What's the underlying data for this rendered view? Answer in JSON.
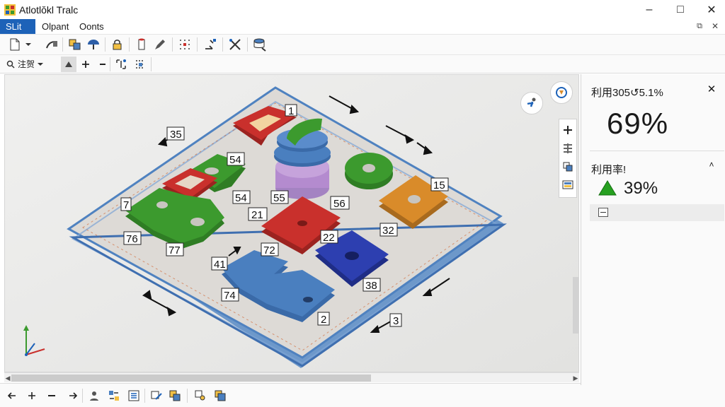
{
  "window": {
    "title": "Atlotlŏkl Tralc",
    "minimize": "–",
    "maximize": "□",
    "close": "✕"
  },
  "menu": {
    "items": [
      "SLit",
      "Olpant",
      "Oonts"
    ],
    "restore_icon": "⧉",
    "close_icon": "✕"
  },
  "toolbar2": {
    "zoom_label": "注贺"
  },
  "viewport": {
    "part_labels": [
      "35",
      "54",
      "54",
      "55",
      "56",
      "76",
      "77",
      "7",
      "21",
      "72",
      "22",
      "32",
      "15",
      "74",
      "38",
      "2",
      "41",
      "3"
    ],
    "dim_labels": [
      "1"
    ]
  },
  "panel": {
    "title": "利用305↺5.1%",
    "big_value": "69%",
    "section_title": "利用率!",
    "indicator_value": "39%",
    "close_icon": "✕",
    "collapse_icon": "˄"
  },
  "colors": {
    "accent": "#1d62b8",
    "plate": "#d9d6d2",
    "plate_edge": "#5f8fc6",
    "green": "#3c9a2e",
    "red": "#c9302c",
    "blue": "#2d3fb0",
    "steel": "#4a7fbf",
    "orange": "#d98b2a",
    "purple": "#b48bcf"
  }
}
